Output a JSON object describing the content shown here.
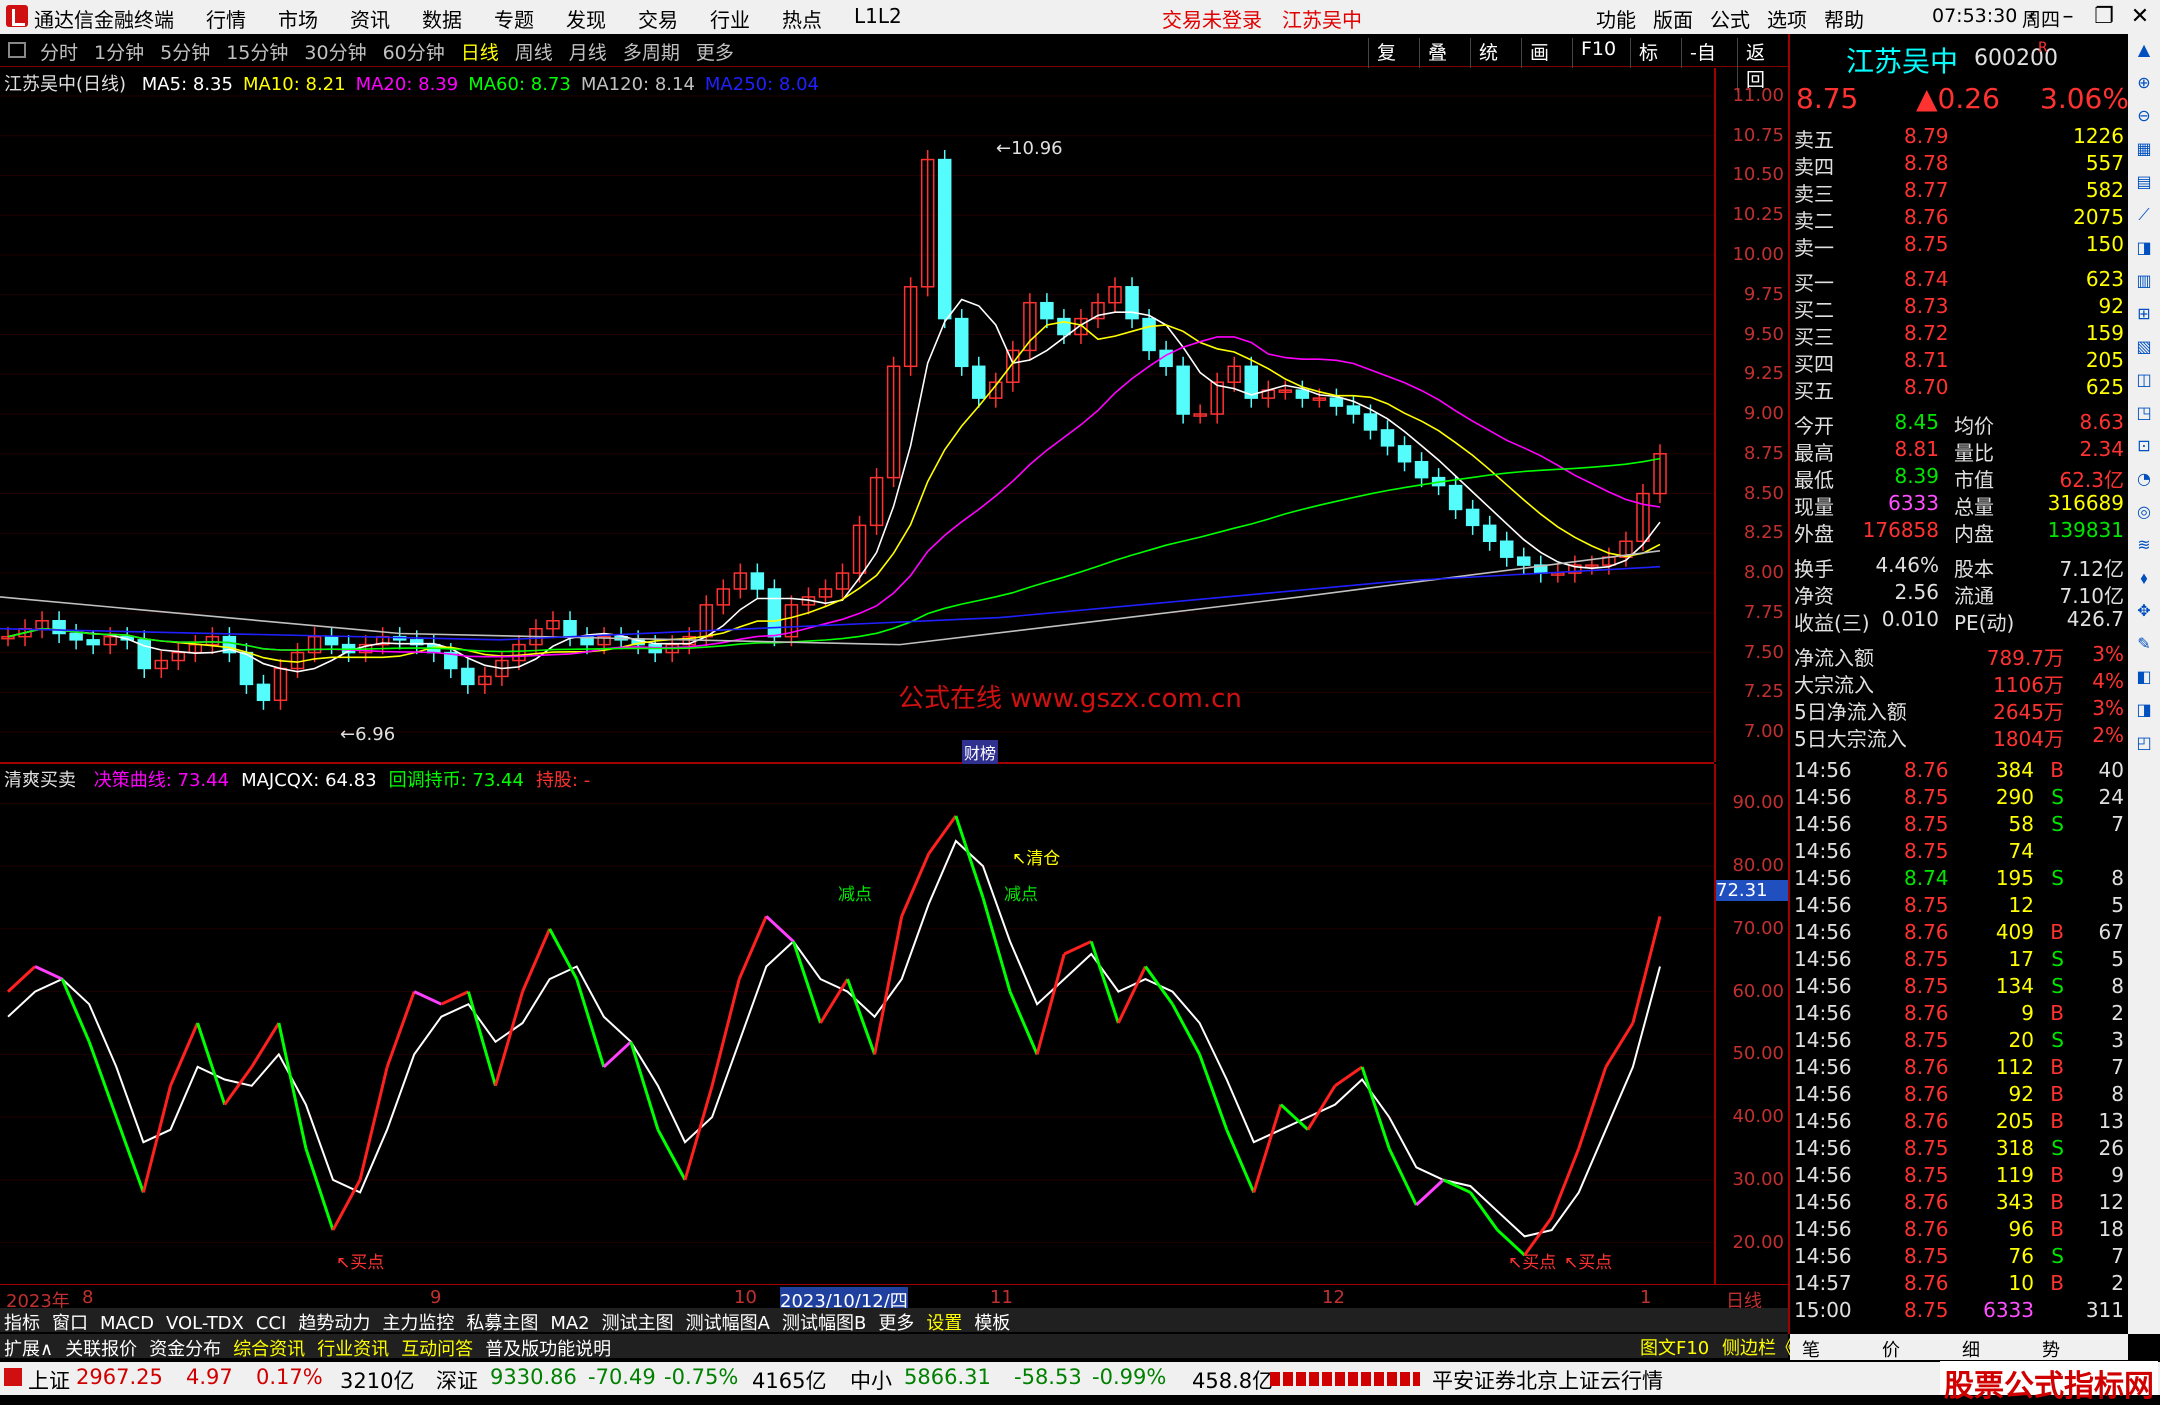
{
  "app": {
    "title": "通达信金融终端",
    "menus": [
      "行情",
      "市场",
      "资讯",
      "数据",
      "专题",
      "发现",
      "交易",
      "行业",
      "热点",
      "L1L2"
    ],
    "login_status": "交易未登录",
    "stock_title": "江苏吴中",
    "right_menus": [
      "功能",
      "版面",
      "公式",
      "选项",
      "帮助"
    ],
    "clock": "07:53:30",
    "weekday": "周四"
  },
  "toolbar": {
    "periods": [
      "分时",
      "1分钟",
      "5分钟",
      "15分钟",
      "30分钟",
      "60分钟",
      "日线",
      "周线",
      "月线",
      "多周期",
      "更多"
    ],
    "selected": "日线",
    "tools": [
      "复权",
      "叠加",
      "统计",
      "画线",
      "F10",
      "标记",
      "-自选",
      "返回"
    ]
  },
  "main_legend": {
    "name": "江苏吴中(日线)",
    "ma": [
      {
        "label": "MA5: 8.35",
        "color": "#ffffff"
      },
      {
        "label": "MA10: 8.21",
        "color": "#ffff00"
      },
      {
        "label": "MA20: 8.39",
        "color": "#ff00ff"
      },
      {
        "label": "MA60: 8.73",
        "color": "#00ff00"
      },
      {
        "label": "MA120: 8.14",
        "color": "#c0c0c0"
      },
      {
        "label": "MA250: 8.04",
        "color": "#2020ff"
      }
    ]
  },
  "main_annotations": {
    "high": "10.96",
    "low": "6.96",
    "watermark": "公式在线  www.gszx.com.cn",
    "badge": "财榜"
  },
  "sub_legend": {
    "name": "清爽买卖",
    "items": [
      {
        "label": "决策曲线: 73.44",
        "color": "#ff00ff"
      },
      {
        "label": "MAJCQX: 64.83",
        "color": "#ffffff"
      },
      {
        "label": "回调持币: 73.44",
        "color": "#00ff00"
      },
      {
        "label": "持股: -",
        "color": "#ff3030"
      }
    ]
  },
  "sub_annotations": {
    "sell_points": [
      "减点",
      "减点"
    ],
    "clear": "清仓",
    "buy_points": [
      "买点",
      "买点",
      "买点"
    ],
    "current_value": "72.31"
  },
  "chart_data": [
    {
      "type": "candlestick",
      "title": "江苏吴中(日线)",
      "ylim": [
        6.9,
        11.05
      ],
      "yticks": [
        "11.00",
        "10.75",
        "10.50",
        "10.25",
        "10.00",
        "9.75",
        "9.50",
        "9.25",
        "9.00",
        "8.75",
        "8.50",
        "8.25",
        "8.00",
        "7.75",
        "7.50",
        "7.25",
        "7.00"
      ],
      "closes": [
        7.6,
        7.65,
        7.7,
        7.62,
        7.58,
        7.55,
        7.6,
        7.58,
        7.4,
        7.45,
        7.5,
        7.55,
        7.6,
        7.5,
        7.3,
        7.2,
        7.4,
        7.5,
        7.6,
        7.55,
        7.5,
        7.55,
        7.6,
        7.58,
        7.55,
        7.5,
        7.4,
        7.3,
        7.35,
        7.45,
        7.55,
        7.65,
        7.7,
        7.6,
        7.55,
        7.6,
        7.58,
        7.55,
        7.5,
        7.55,
        7.6,
        7.8,
        7.9,
        8.0,
        7.9,
        7.6,
        7.8,
        7.85,
        7.9,
        8.0,
        8.3,
        8.6,
        9.3,
        9.8,
        10.6,
        9.6,
        9.3,
        9.1,
        9.2,
        9.4,
        9.7,
        9.6,
        9.5,
        9.6,
        9.7,
        9.8,
        9.6,
        9.4,
        9.3,
        9.0,
        9.0,
        9.2,
        9.3,
        9.1,
        9.15,
        9.15,
        9.1,
        9.1,
        9.05,
        9.0,
        8.9,
        8.8,
        8.7,
        8.6,
        8.55,
        8.4,
        8.3,
        8.2,
        8.1,
        8.05,
        8.0,
        8.0,
        8.05,
        8.05,
        8.1,
        8.2,
        8.5,
        8.75
      ]
    },
    {
      "type": "line",
      "title": "清爽买卖",
      "ylim": [
        15,
        95
      ],
      "yticks": [
        "90.00",
        "80.00",
        "70.00",
        "60.00",
        "50.00",
        "40.00",
        "30.00",
        "20.00"
      ],
      "series": [
        {
          "name": "决策曲线",
          "values": [
            60,
            64,
            62,
            52,
            40,
            28,
            45,
            55,
            42,
            48,
            55,
            35,
            22,
            30,
            48,
            60,
            58,
            60,
            45,
            60,
            70,
            62,
            48,
            52,
            38,
            30,
            45,
            62,
            72,
            68,
            55,
            62,
            50,
            72,
            82,
            88,
            75,
            60,
            50,
            66,
            68,
            55,
            64,
            58,
            50,
            38,
            28,
            42,
            38,
            45,
            48,
            35,
            26,
            30,
            28,
            22,
            18,
            24,
            35,
            48,
            55,
            72
          ]
        },
        {
          "name": "MAJCQX",
          "values": [
            56,
            60,
            62,
            58,
            48,
            36,
            38,
            48,
            46,
            45,
            50,
            42,
            30,
            28,
            38,
            50,
            56,
            58,
            52,
            55,
            62,
            64,
            56,
            52,
            45,
            36,
            40,
            52,
            64,
            68,
            62,
            60,
            56,
            62,
            74,
            84,
            80,
            68,
            58,
            62,
            66,
            60,
            62,
            60,
            55,
            46,
            36,
            38,
            40,
            42,
            46,
            40,
            32,
            30,
            29,
            25,
            21,
            22,
            28,
            38,
            48,
            64
          ]
        }
      ]
    }
  ],
  "date_axis": [
    "2023年",
    "8",
    "9",
    "10",
    "2023/10/12/四",
    "11",
    "12",
    "1",
    "日线"
  ],
  "indicator_tabs": [
    "指标",
    "窗口",
    "MACD",
    "VOL-TDX",
    "CCI",
    "趋势动力",
    "主力监控",
    "私募主图",
    "MA2",
    "测试主图",
    "测试幅图A",
    "测试幅图B",
    "更多",
    "设置",
    "模板"
  ],
  "info_tabs": [
    "扩展∧",
    "关联报价",
    "资金分布",
    "综合资讯",
    "行业资讯",
    "互动问答",
    "普及版功能说明"
  ],
  "quote": {
    "name": "江苏吴中",
    "code": "600200",
    "price": "8.75",
    "change": "▲0.26",
    "pct": "3.06%",
    "asks": [
      [
        "卖五",
        "8.79",
        "1226"
      ],
      [
        "卖四",
        "8.78",
        "557"
      ],
      [
        "卖三",
        "8.77",
        "582"
      ],
      [
        "卖二",
        "8.76",
        "2075"
      ],
      [
        "卖一",
        "8.75",
        "150"
      ]
    ],
    "bids": [
      [
        "买一",
        "8.74",
        "623"
      ],
      [
        "买二",
        "8.73",
        "92"
      ],
      [
        "买三",
        "8.72",
        "159"
      ],
      [
        "买四",
        "8.71",
        "205"
      ],
      [
        "买五",
        "8.70",
        "625"
      ]
    ],
    "stats": [
      [
        "今开",
        "8.45",
        "均价",
        "8.63"
      ],
      [
        "最高",
        "8.81",
        "量比",
        "2.34"
      ],
      [
        "最低",
        "8.39",
        "市值",
        "62.3亿"
      ],
      [
        "现量",
        "6333",
        "总量",
        "316689"
      ],
      [
        "外盘",
        "176858",
        "内盘",
        "139831"
      ]
    ],
    "stats2": [
      [
        "换手",
        "4.46%",
        "股本",
        "7.12亿"
      ],
      [
        "净资",
        "2.56",
        "流通",
        "7.10亿"
      ],
      [
        "收益(三)",
        "0.010",
        "PE(动)",
        "426.7"
      ]
    ],
    "flows": [
      [
        "净流入额",
        "789.7万",
        "3%"
      ],
      [
        "大宗流入",
        "1106万",
        "4%"
      ],
      [
        "5日净流入额",
        "2645万",
        "3%"
      ],
      [
        "5日大宗流入",
        "1804万",
        "2%"
      ]
    ],
    "ticks": [
      [
        "14:56",
        "8.76",
        "384",
        "B",
        "40"
      ],
      [
        "14:56",
        "8.75",
        "290",
        "S",
        "24"
      ],
      [
        "14:56",
        "8.75",
        "58",
        "S",
        "7"
      ],
      [
        "14:56",
        "8.75",
        "74",
        "",
        ""
      ],
      [
        "14:56",
        "8.74",
        "195",
        "S",
        "8"
      ],
      [
        "14:56",
        "8.75",
        "12",
        "",
        "5"
      ],
      [
        "14:56",
        "8.76",
        "409",
        "B",
        "67"
      ],
      [
        "14:56",
        "8.75",
        "17",
        "S",
        "5"
      ],
      [
        "14:56",
        "8.75",
        "134",
        "S",
        "8"
      ],
      [
        "14:56",
        "8.76",
        "9",
        "B",
        "2"
      ],
      [
        "14:56",
        "8.75",
        "20",
        "S",
        "3"
      ],
      [
        "14:56",
        "8.76",
        "112",
        "B",
        "7"
      ],
      [
        "14:56",
        "8.76",
        "92",
        "B",
        "8"
      ],
      [
        "14:56",
        "8.76",
        "205",
        "B",
        "13"
      ],
      [
        "14:56",
        "8.75",
        "318",
        "S",
        "26"
      ],
      [
        "14:56",
        "8.75",
        "119",
        "B",
        "9"
      ],
      [
        "14:56",
        "8.76",
        "343",
        "B",
        "12"
      ],
      [
        "14:56",
        "8.76",
        "96",
        "B",
        "18"
      ],
      [
        "14:56",
        "8.75",
        "76",
        "S",
        "7"
      ],
      [
        "14:57",
        "8.76",
        "10",
        "B",
        "2"
      ],
      [
        "15:00",
        "8.75",
        "6333",
        "",
        "311"
      ]
    ]
  },
  "quote_tabs": [
    "笔",
    "价",
    "细",
    "势"
  ],
  "status": {
    "sh_label": "上证",
    "sh_val": "2967.25",
    "sh_chg": "4.97",
    "sh_pct": "0.17%",
    "sh_amt": "3210亿",
    "sz_label": "深证",
    "sz_val": "9330.86",
    "sz_chg": "-70.49",
    "sz_pct": "-0.75%",
    "sz_amt": "4165亿",
    "zx_label": "中小",
    "zx_val": "5866.31",
    "zx_chg": "-58.53",
    "zx_pct": "-0.99%",
    "zx_amt": "458.8亿",
    "broker": "平安证券北京上证云行情",
    "f10": "图文F10",
    "sidebar": "侧边栏《",
    "brand": "股票公式指标网",
    "brand_url": "www.gszx.com.cn"
  }
}
